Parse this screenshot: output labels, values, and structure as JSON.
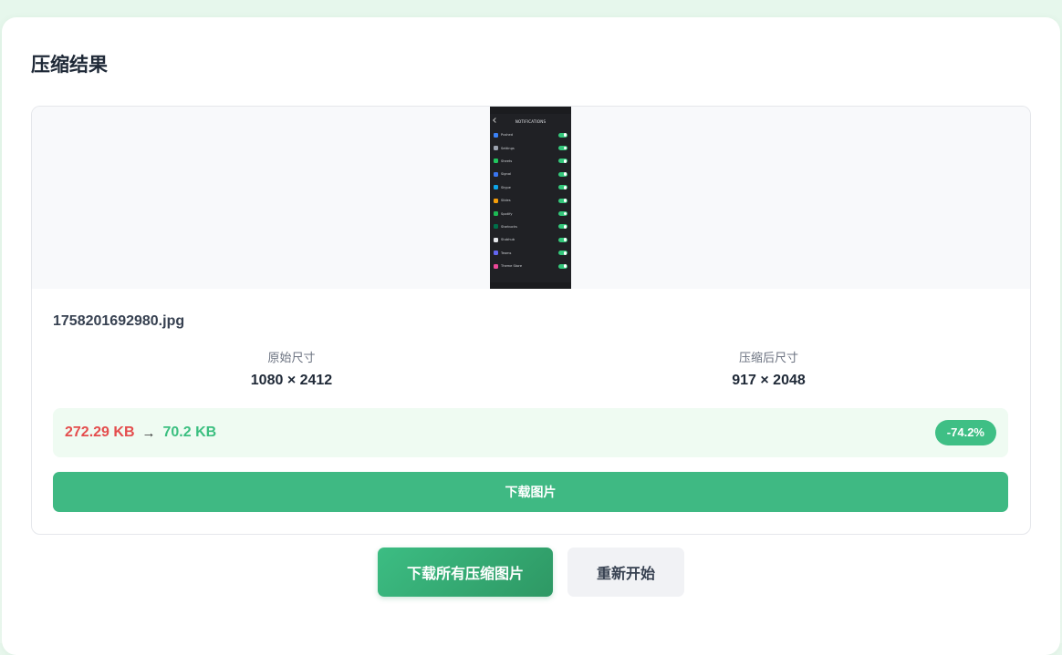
{
  "card": {
    "title": "压缩结果"
  },
  "result": {
    "filename": "1758201692980.jpg",
    "original_label": "原始尺寸",
    "original_dims": "1080 × 2412",
    "compressed_label": "压缩后尺寸",
    "compressed_dims": "917 × 2048",
    "original_size": "272.29 KB",
    "arrow": "→",
    "compressed_size": "70.2 KB",
    "reduction": "-74.2%",
    "download_label": "下载图片"
  },
  "preview": {
    "header": "NOTIFICATIONS",
    "apps": [
      {
        "name": "Pushed",
        "color": "#3b82f6"
      },
      {
        "name": "Settings",
        "color": "#9ca3af"
      },
      {
        "name": "Sheets",
        "color": "#22c55e"
      },
      {
        "name": "Signal",
        "color": "#3a76f0"
      },
      {
        "name": "Skype",
        "color": "#0ea5e9"
      },
      {
        "name": "Slides",
        "color": "#f59e0b"
      },
      {
        "name": "Spotify",
        "color": "#1db954"
      },
      {
        "name": "Starbucks",
        "color": "#00704a"
      },
      {
        "name": "Stubhub",
        "color": "#e5e7eb"
      },
      {
        "name": "Teams",
        "color": "#6366f1"
      },
      {
        "name": "Theme Store",
        "color": "#ec4899"
      }
    ]
  },
  "actions": {
    "download_all": "下载所有压缩图片",
    "restart": "重新开始"
  },
  "colors": {
    "accent": "#3fb983",
    "original_size": "#e44d4d",
    "compressed_size": "#3bbf80"
  }
}
